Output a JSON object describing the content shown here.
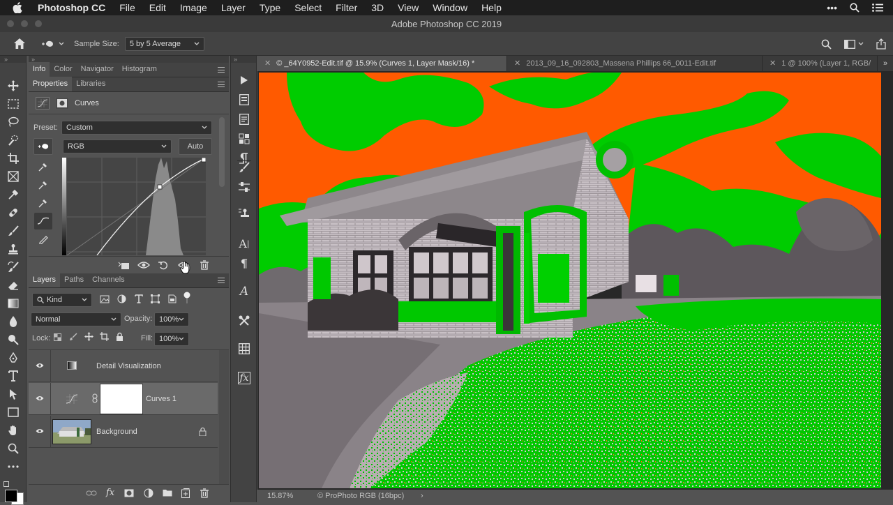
{
  "menubar": {
    "app_name": "Photoshop CC",
    "items": [
      "File",
      "Edit",
      "Image",
      "Layer",
      "Type",
      "Select",
      "Filter",
      "3D",
      "View",
      "Window",
      "Help"
    ]
  },
  "window": {
    "title": "Adobe Photoshop CC 2019"
  },
  "options_bar": {
    "sample_size_label": "Sample Size:",
    "sample_size_value": "5 by 5 Average"
  },
  "panels": {
    "top_tabs": [
      "Info",
      "Color",
      "Navigator",
      "Histogram"
    ],
    "properties_tabs": [
      "Properties",
      "Libraries"
    ],
    "properties": {
      "type_label": "Curves",
      "preset_label": "Preset:",
      "preset_value": "Custom",
      "channel_value": "RGB",
      "auto_label": "Auto"
    },
    "layers_tabs": [
      "Layers",
      "Paths",
      "Channels"
    ],
    "layers": {
      "filter_kind": "Kind",
      "blend_mode": "Normal",
      "opacity_label": "Opacity:",
      "opacity_value": "100%",
      "lock_label": "Lock:",
      "fill_label": "Fill:",
      "fill_value": "100%",
      "items": [
        {
          "name": "Detail Visualization"
        },
        {
          "name": "Curves 1"
        },
        {
          "name": "Background"
        }
      ]
    }
  },
  "document_tabs": [
    {
      "label": "© _64Y0952-Edit.tif @ 15.9% (Curves 1, Layer Mask/16) *"
    },
    {
      "label": "2013_09_16_092803_Massena Phillips 66_0011-Edit.tif"
    },
    {
      "label": "1 @ 100% (Layer 1, RGB/"
    }
  ],
  "status_bar": {
    "zoom": "15.87%",
    "profile": "© ProPhoto RGB (16bpc)"
  },
  "colors": {
    "sky_highlight": "#ff5a00",
    "detail_green": "#00cc00",
    "ui_dark": "#434343"
  }
}
